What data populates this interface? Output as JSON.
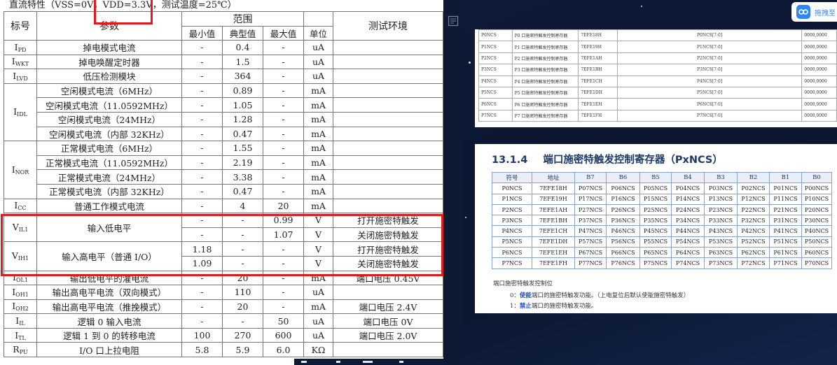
{
  "left_page": {
    "heading": "直流特性（VSS=0V，VDD=3.3V，测试温度=25℃）",
    "columns": {
      "symbol": "标号",
      "param": "参数",
      "range": "范围",
      "min": "最小值",
      "typ": "典型值",
      "max": "最大值",
      "unit": "单位",
      "env": "测试环境"
    },
    "rows": [
      {
        "sym": "I",
        "sub": "PD",
        "param": "掉电模式电流",
        "min": "-",
        "typ": "0.4",
        "max": "-",
        "unit": "uA",
        "env": ""
      },
      {
        "sym": "I",
        "sub": "WKT",
        "param": "掉电唤醒定时器",
        "min": "-",
        "typ": "1.5",
        "max": "-",
        "unit": "uA",
        "env": ""
      },
      {
        "sym": "I",
        "sub": "LVD",
        "param": "低压检测模块",
        "min": "-",
        "typ": "364",
        "max": "-",
        "unit": "uA",
        "env": ""
      },
      {
        "sym": "I",
        "sub": "IDL",
        "param": "空闲模式电流（6MHz）",
        "min": "-",
        "typ": "0.89",
        "max": "-",
        "unit": "mA",
        "env": ""
      },
      {
        "sym": "",
        "sub": "",
        "param": "空闲模式电流（11.0592MHz）",
        "min": "-",
        "typ": "1.05",
        "max": "-",
        "unit": "mA",
        "env": ""
      },
      {
        "sym": "",
        "sub": "",
        "param": "空闲模式电流（24MHz）",
        "min": "-",
        "typ": "1.28",
        "max": "-",
        "unit": "mA",
        "env": ""
      },
      {
        "sym": "",
        "sub": "",
        "param": "空闲模式电流（内部 32KHz）",
        "min": "-",
        "typ": "0.47",
        "max": "-",
        "unit": "mA",
        "env": ""
      },
      {
        "sym": "I",
        "sub": "NOR",
        "param": "正常模式电流（6MHz）",
        "min": "-",
        "typ": "1.55",
        "max": "-",
        "unit": "mA",
        "env": ""
      },
      {
        "sym": "",
        "sub": "",
        "param": "正常模式电流（11.0592MHz）",
        "min": "-",
        "typ": "2.19",
        "max": "-",
        "unit": "mA",
        "env": ""
      },
      {
        "sym": "",
        "sub": "",
        "param": "正常模式电流（24MHz）",
        "min": "-",
        "typ": "3.38",
        "max": "-",
        "unit": "mA",
        "env": ""
      },
      {
        "sym": "",
        "sub": "",
        "param": "正常模式电流（内部 32KHz）",
        "min": "-",
        "typ": "0.47",
        "max": "-",
        "unit": "mA",
        "env": ""
      },
      {
        "sym": "I",
        "sub": "CC",
        "param": "普通工作模式电流",
        "min": "-",
        "typ": "4",
        "max": "20",
        "unit": "mA",
        "env": ""
      },
      {
        "sym": "V",
        "sub": "IL1",
        "param": "输入低电平",
        "min": "-",
        "typ": "-",
        "max": "0.99",
        "unit": "V",
        "env": "打开施密特触发"
      },
      {
        "sym": "",
        "sub": "",
        "param": "",
        "min": "-",
        "typ": "-",
        "max": "1.07",
        "unit": "V",
        "env": "关闭施密特触发"
      },
      {
        "sym": "V",
        "sub": "IH1",
        "param": "输入高电平（普通 I/O）",
        "min": "1.18",
        "typ": "-",
        "max": "-",
        "unit": "V",
        "env": "打开施密特触发"
      },
      {
        "sym": "",
        "sub": "",
        "param": "",
        "min": "1.09",
        "typ": "-",
        "max": "-",
        "unit": "V",
        "env": "关闭施密特触发"
      },
      {
        "sym": "I",
        "sub": "OL1",
        "param": "输出低电平的灌电流",
        "min": "-",
        "typ": "20",
        "max": "-",
        "unit": "mA",
        "env": "端口电压 0.45V"
      },
      {
        "sym": "I",
        "sub": "OH1",
        "param": "输出高电平电流（双向模式）",
        "min": "-",
        "typ": "110",
        "max": "-",
        "unit": "uA",
        "env": ""
      },
      {
        "sym": "I",
        "sub": "OH2",
        "param": "输出高电平电流（推挽模式）",
        "min": "-",
        "typ": "20",
        "max": "-",
        "unit": "mA",
        "env": "端口电压 2.4V"
      },
      {
        "sym": "I",
        "sub": "IL",
        "param": "逻辑 0 输入电流",
        "min": "-",
        "typ": "-",
        "max": "50",
        "unit": "uA",
        "env": "端口电压 0V"
      },
      {
        "sym": "I",
        "sub": "TL",
        "param": "逻辑 1 到 0 的转移电流",
        "min": "100",
        "typ": "270",
        "max": "600",
        "unit": "uA",
        "env": "端口电压 2.0V"
      },
      {
        "sym": "R",
        "sub": "PU",
        "param": "I/O 口上拉电阻",
        "min": "5.8",
        "typ": "5.9",
        "max": "6.0",
        "unit": "KΩ",
        "env": ""
      }
    ]
  },
  "viewer": {
    "bubble_label": "拖拽至",
    "top_rows": [
      {
        "name": "P0NCS",
        "desc": "P0 口施密特触发控制寄存器",
        "addr": "7EFE18H",
        "field": "P0NCS[7:0]",
        "reset": "0000,0000"
      },
      {
        "name": "P1NCS",
        "desc": "P1 口施密特触发控制寄存器",
        "addr": "7EFE19H",
        "field": "P1NCS[7:0]",
        "reset": "0000,0000"
      },
      {
        "name": "P2NCS",
        "desc": "P2 口施密特触发控制寄存器",
        "addr": "7EFE1AH",
        "field": "P2NCS[7:0]",
        "reset": "0000,0000"
      },
      {
        "name": "P3NCS",
        "desc": "P3 口施密特触发控制寄存器",
        "addr": "7EFE1BH",
        "field": "P3NCS[7:0]",
        "reset": "0000,0000"
      },
      {
        "name": "P4NCS",
        "desc": "P4 口施密特触发控制寄存器",
        "addr": "7EFE1CH",
        "field": "P4NCS[7:0]",
        "reset": "0000,0000"
      },
      {
        "name": "P5NCS",
        "desc": "P5 口施密特触发控制寄存器",
        "addr": "7EFE1DH",
        "field": "P5NCS[7:0]",
        "reset": "0000,0000"
      },
      {
        "name": "P6NCS",
        "desc": "P6 口施密特触发控制寄存器",
        "addr": "7EFE1EH",
        "field": "P6NCS[7:0]",
        "reset": "0000,0000"
      },
      {
        "name": "P7NCS",
        "desc": "P7 口施密特触发控制寄存器",
        "addr": "7EFE1FH",
        "field": "P7NCS[7:0]",
        "reset": "0000,0000"
      }
    ],
    "section_number": "13.1.4",
    "section_title": "端口施密特触发控制寄存器（PxNCS）",
    "reg_headers": [
      "符号",
      "地址",
      "B7",
      "B6",
      "B5",
      "B4",
      "B3",
      "B2",
      "B1",
      "B0"
    ],
    "reg_rows": [
      [
        "P0NCS",
        "7EFE18H",
        "P07NCS",
        "P06NCS",
        "P05NCS",
        "P04NCS",
        "P03NCS",
        "P02NCS",
        "P01NCS",
        "P00NCS"
      ],
      [
        "P1NCS",
        "7EFE19H",
        "P17NCS",
        "P16NCS",
        "P15NCS",
        "P14NCS",
        "P13NCS",
        "P12NCS",
        "P11NCS",
        "P10NCS"
      ],
      [
        "P2NCS",
        "7EFE1AH",
        "P27NCS",
        "P26NCS",
        "P25NCS",
        "P24NCS",
        "P23NCS",
        "P22NCS",
        "P21NCS",
        "P20NCS"
      ],
      [
        "P3NCS",
        "7EFE1BH",
        "P37NCS",
        "P36NCS",
        "P35NCS",
        "P34NCS",
        "P33NCS",
        "P32NCS",
        "P31NCS",
        "P30NCS"
      ],
      [
        "P4NCS",
        "7EFE1CH",
        "P47NCS",
        "P46NCS",
        "P45NCS",
        "P44NCS",
        "P43NCS",
        "P42NCS",
        "P41NCS",
        "P40NCS"
      ],
      [
        "P5NCS",
        "7EFE1DH",
        "P57NCS",
        "P56NCS",
        "P55NCS",
        "P54NCS",
        "P53NCS",
        "P52NCS",
        "P51NCS",
        "P50NCS"
      ],
      [
        "P6NCS",
        "7EFE1EH",
        "P67NCS",
        "P66NCS",
        "P65NCS",
        "P64NCS",
        "P63NCS",
        "P62NCS",
        "P61NCS",
        "P60NCS"
      ],
      [
        "P7NCS",
        "7EFE1FH",
        "P77NCS",
        "P76NCS",
        "P75NCS",
        "P74NCS",
        "P73NCS",
        "P72NCS",
        "P71NCS",
        "P70NCS"
      ]
    ],
    "note_title": "端口施密特触发控制位",
    "note_0_key": "0：",
    "note_0_strong": "使能",
    "note_0_rest": "端口的施密特触发功能。（上电复位后默认使能施密特触发）",
    "note_1_key": "1：",
    "note_1_strong": "禁止",
    "note_1_rest": "端口的施密特触发功能。"
  },
  "colors": {
    "highlight": "#e01b1b",
    "viewer_bg": "#0e1a36",
    "emphasis": "#1f4fc2"
  },
  "icons": [
    "export-icon",
    "cloud-app-icon"
  ]
}
